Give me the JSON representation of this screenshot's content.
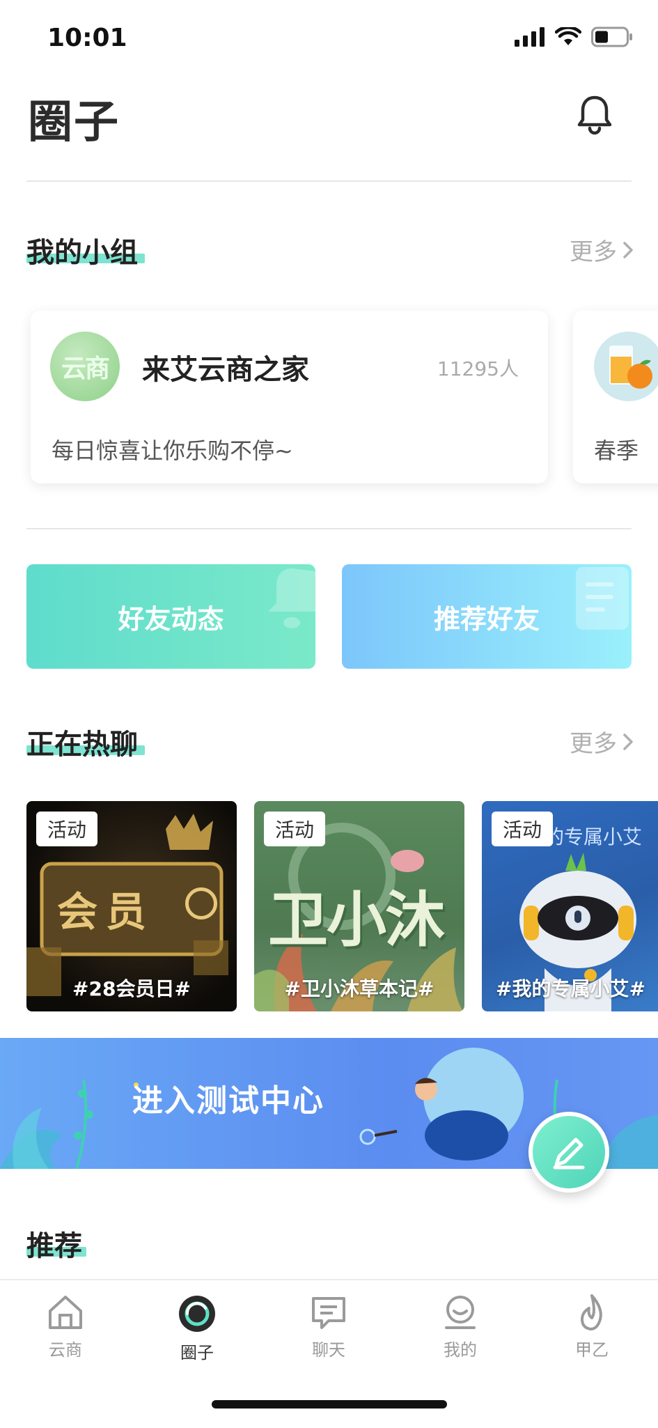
{
  "status": {
    "time": "10:01"
  },
  "header": {
    "title": "圈子"
  },
  "my_groups": {
    "title": "我的小组",
    "more": "更多",
    "cards": [
      {
        "avatar_text": "云商",
        "name": "来艾云商之家",
        "count": "11295人",
        "desc": "每日惊喜让你乐购不停~"
      },
      {
        "desc": "春季"
      }
    ]
  },
  "actions": {
    "friends_feed": "好友动态",
    "recommend_friends": "推荐好友"
  },
  "hot_chat": {
    "title": "正在热聊",
    "more": "更多",
    "cards": [
      {
        "tag": "活动",
        "caption": "#28会员日#",
        "art_text": "会员"
      },
      {
        "tag": "活动",
        "caption": "#卫小沐草本记#",
        "art_text": "卫小沐"
      },
      {
        "tag": "活动",
        "caption": "#我的专属小艾#",
        "art_text": "的专属小艾"
      }
    ]
  },
  "banner": {
    "text": "进入测试中心"
  },
  "recommend": {
    "title": "推荐"
  },
  "tabbar": {
    "items": [
      {
        "label": "云商",
        "icon": "home-icon"
      },
      {
        "label": "圈子",
        "icon": "circle-icon",
        "active": true
      },
      {
        "label": "聊天",
        "icon": "chat-icon"
      },
      {
        "label": "我的",
        "icon": "profile-icon"
      },
      {
        "label": "甲乙",
        "icon": "flame-icon"
      }
    ]
  },
  "colors": {
    "accent": "#5fe0c4",
    "underline": "#7ee3d0",
    "banner": "#5b8cf0"
  }
}
